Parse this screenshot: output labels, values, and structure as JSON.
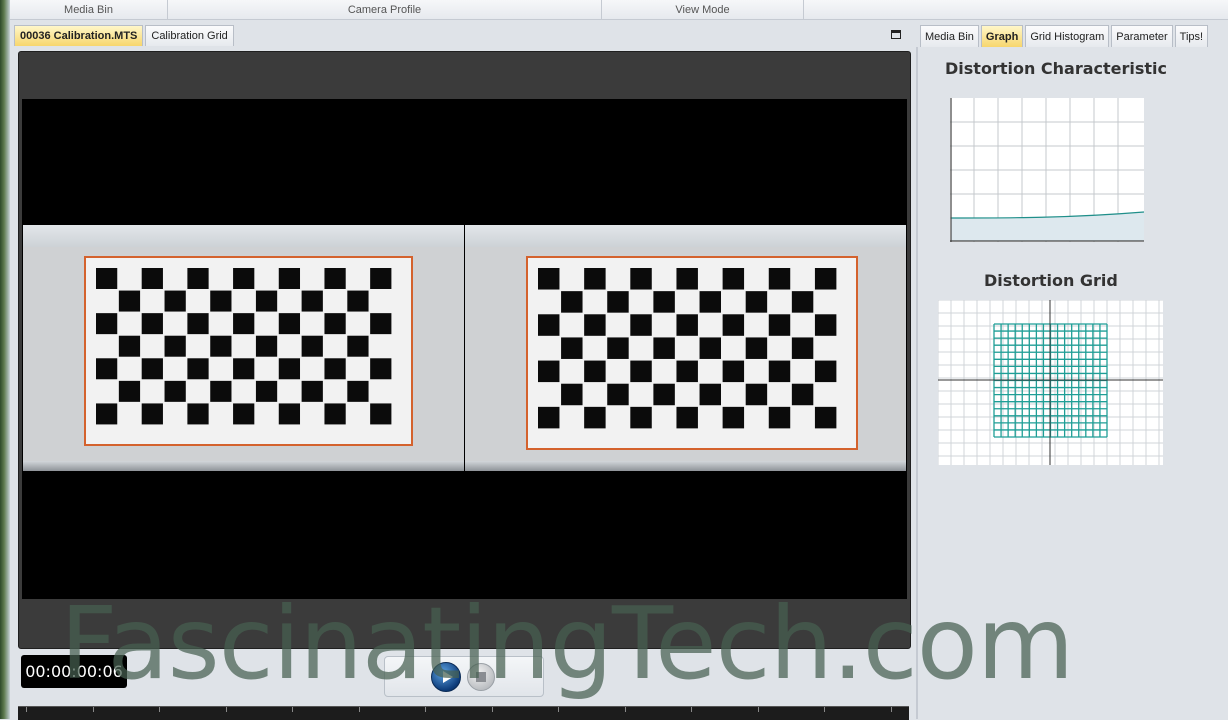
{
  "toolbar": {
    "groups": [
      "Media Bin",
      "Camera Profile",
      "View Mode"
    ]
  },
  "doc_tabs": [
    "00036 Calibration.MTS",
    "Calibration Grid"
  ],
  "right_tabs": [
    "Media Bin",
    "Graph",
    "Grid Histogram",
    "Parameter",
    "Tips!"
  ],
  "graph_panel": {
    "characteristic_title": "Distortion Characteristic",
    "grid_title": "Distortion Grid",
    "curve_color": "#1f8f8a",
    "grid_color": "#1f9e96"
  },
  "player": {
    "timecode": "00:00:00:06",
    "play_icon": "play-icon",
    "stop_icon": "stop-icon"
  },
  "watermark": "FascinatingTech.com",
  "colors": {
    "active_tab": "#f7d66d",
    "board_border": "#d4622d"
  }
}
